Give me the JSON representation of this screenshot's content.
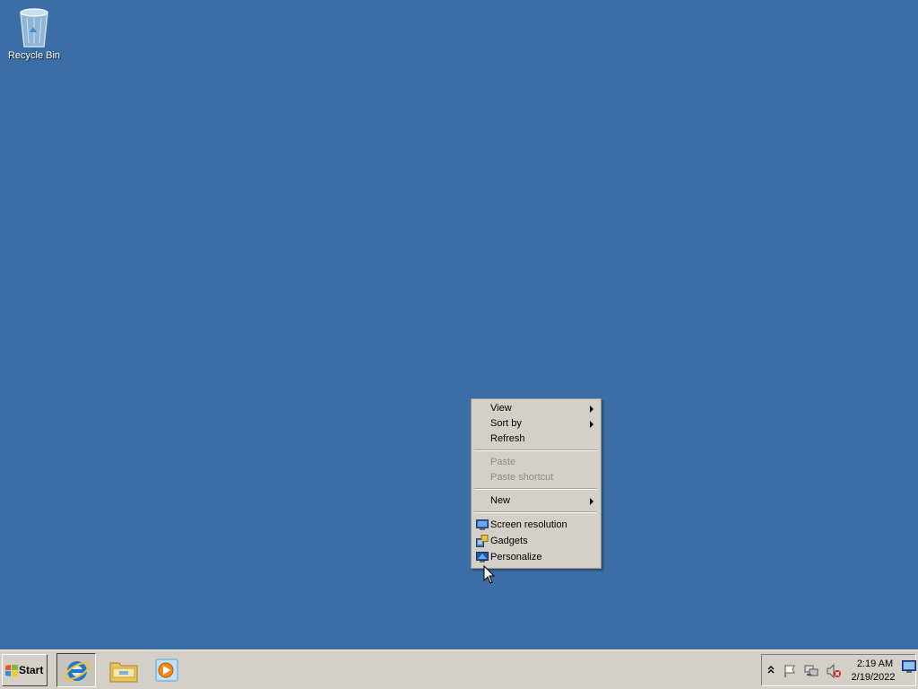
{
  "desktop": {
    "background_color": "#3b6ea6",
    "icons": [
      {
        "label": "Recycle Bin",
        "icon": "recycle-bin-icon"
      }
    ]
  },
  "context_menu": {
    "items": [
      {
        "label": "View",
        "enabled": true,
        "submenu": true
      },
      {
        "label": "Sort by",
        "enabled": true,
        "submenu": true
      },
      {
        "label": "Refresh",
        "enabled": true,
        "submenu": false
      },
      {
        "label": "Paste",
        "enabled": false,
        "submenu": false
      },
      {
        "label": "Paste shortcut",
        "enabled": false,
        "submenu": false
      },
      {
        "label": "New",
        "enabled": true,
        "submenu": true
      },
      {
        "label": "Screen resolution",
        "enabled": true,
        "icon": "screen-resolution-icon"
      },
      {
        "label": "Gadgets",
        "enabled": true,
        "icon": "gadgets-icon"
      },
      {
        "label": "Personalize",
        "enabled": true,
        "icon": "personalize-icon"
      }
    ]
  },
  "taskbar": {
    "start_label": "Start",
    "pinned": [
      {
        "name": "Internet Explorer",
        "icon": "internet-explorer-icon"
      },
      {
        "name": "Windows Explorer",
        "icon": "file-explorer-icon"
      },
      {
        "name": "Windows Media Player",
        "icon": "media-player-icon"
      }
    ],
    "tray": {
      "icons": [
        "show-hidden-icons-icon",
        "action-center-flag-icon",
        "network-icon",
        "volume-muted-icon"
      ],
      "time": "2:19 AM",
      "date": "2/19/2022"
    }
  }
}
